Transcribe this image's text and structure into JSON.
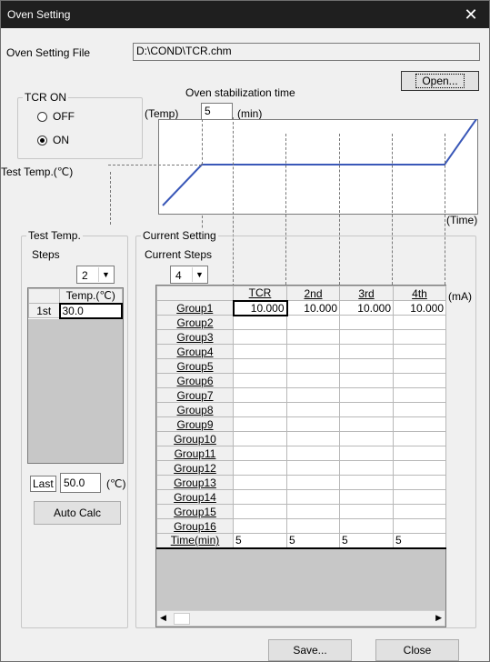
{
  "window": {
    "title": "Oven Setting",
    "close_glyph": "✕"
  },
  "file": {
    "label": "Oven Setting File",
    "path": "D:\\COND\\TCR.chm",
    "open_button": "Open..."
  },
  "tcr": {
    "group_label": "TCR ON",
    "off_label": "OFF",
    "on_label": "ON",
    "selected": "ON"
  },
  "stabilization": {
    "label": "Oven stabilization time",
    "temp_label": "(Temp)",
    "value": "5",
    "unit": "(min)"
  },
  "diagram": {
    "test_temp_label": "Test Temp.(℃)",
    "time_label": "(Time)"
  },
  "test_temp": {
    "group_label": "Test Temp.",
    "steps_label": "Steps",
    "steps_value": "2",
    "col_header": "Temp.(℃)",
    "rows": [
      {
        "step": "1st",
        "temp": "30.0"
      }
    ],
    "last_label": "Last",
    "last_value": "50.0",
    "last_unit": "(℃)",
    "auto_calc": "Auto Calc"
  },
  "current": {
    "group_label": "Current Setting",
    "steps_label": "Current Steps",
    "steps_value": "4",
    "unit": "(mA)",
    "columns": [
      "TCR",
      "2nd",
      "3rd",
      "4th"
    ],
    "groups": [
      {
        "name": "Group1",
        "values": [
          "10.000",
          "10.000",
          "10.000",
          "10.000"
        ]
      },
      {
        "name": "Group2",
        "values": [
          "",
          "",
          "",
          ""
        ]
      },
      {
        "name": "Group3",
        "values": [
          "",
          "",
          "",
          ""
        ]
      },
      {
        "name": "Group4",
        "values": [
          "",
          "",
          "",
          ""
        ]
      },
      {
        "name": "Group5",
        "values": [
          "",
          "",
          "",
          ""
        ]
      },
      {
        "name": "Group6",
        "values": [
          "",
          "",
          "",
          ""
        ]
      },
      {
        "name": "Group7",
        "values": [
          "",
          "",
          "",
          ""
        ]
      },
      {
        "name": "Group8",
        "values": [
          "",
          "",
          "",
          ""
        ]
      },
      {
        "name": "Group9",
        "values": [
          "",
          "",
          "",
          ""
        ]
      },
      {
        "name": "Group10",
        "values": [
          "",
          "",
          "",
          ""
        ]
      },
      {
        "name": "Group11",
        "values": [
          "",
          "",
          "",
          ""
        ]
      },
      {
        "name": "Group12",
        "values": [
          "",
          "",
          "",
          ""
        ]
      },
      {
        "name": "Group13",
        "values": [
          "",
          "",
          "",
          ""
        ]
      },
      {
        "name": "Group14",
        "values": [
          "",
          "",
          "",
          ""
        ]
      },
      {
        "name": "Group15",
        "values": [
          "",
          "",
          "",
          ""
        ]
      },
      {
        "name": "Group16",
        "values": [
          "",
          "",
          "",
          ""
        ]
      }
    ],
    "time_label": "Time(min)",
    "times": [
      "5",
      "5",
      "5",
      "5"
    ]
  },
  "footer": {
    "save_button": "Save...",
    "close_button": "Close"
  }
}
